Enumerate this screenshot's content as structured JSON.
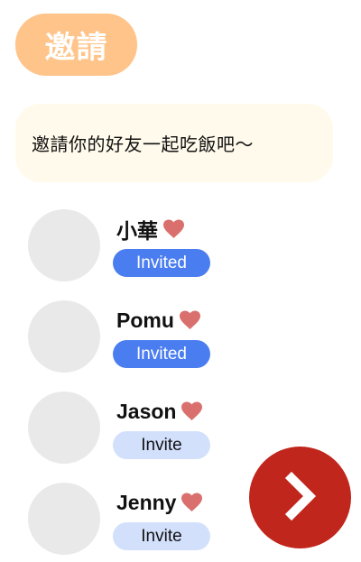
{
  "header": {
    "title": "邀請"
  },
  "message": {
    "text": "邀請你的好友一起吃飯吧～"
  },
  "friends": [
    {
      "name": "小華",
      "status_label": "Invited",
      "status": "invited",
      "favorite": true
    },
    {
      "name": "Pomu",
      "status_label": "Invited",
      "status": "invited",
      "favorite": true
    },
    {
      "name": "Jason",
      "status_label": "Invite",
      "status": "invite",
      "favorite": true
    },
    {
      "name": "Jenny",
      "status_label": "Invite",
      "status": "invite",
      "favorite": true
    }
  ],
  "icons": {
    "favorite": "heart-icon",
    "next": "chevron-right-icon"
  },
  "colors": {
    "title_pill": "#FFC48A",
    "message_card": "#FFFAEB",
    "avatar_placeholder": "#E9E9E9",
    "heart": "#D9706E",
    "invited_button": "#4A7DF0",
    "invite_button": "#D3E0FC",
    "next_button": "#C0261C"
  }
}
